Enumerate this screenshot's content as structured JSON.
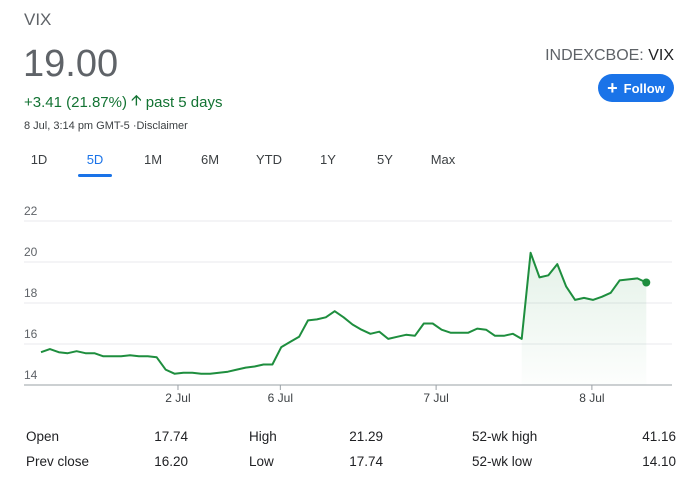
{
  "ticker": "VIX",
  "price": "19.00",
  "exchange": {
    "prefix": "INDEXCBOE: ",
    "symbol": "VIX"
  },
  "follow_label": "Follow",
  "change": {
    "value": "+3.41 (21.87%)",
    "period": "past 5 days"
  },
  "meta": "8 Jul, 3:14 pm GMT-5 ·Disclaimer",
  "tabs": [
    {
      "label": "1D",
      "active": false
    },
    {
      "label": "5D",
      "active": true
    },
    {
      "label": "1M",
      "active": false
    },
    {
      "label": "6M",
      "active": false
    },
    {
      "label": "YTD",
      "active": false
    },
    {
      "label": "1Y",
      "active": false
    },
    {
      "label": "5Y",
      "active": false
    },
    {
      "label": "Max",
      "active": false
    }
  ],
  "colors": {
    "accent": "#1a73e8",
    "positive": "#137333",
    "line": "#1e8e3e"
  },
  "chart_data": {
    "type": "area",
    "x_tick_labels": [
      "2 Jul",
      "6 Jul",
      "7 Jul",
      "8 Jul"
    ],
    "y_ticks": [
      14,
      16,
      18,
      20,
      22
    ],
    "ylim": [
      14,
      22
    ],
    "x": [
      0,
      1,
      2,
      3,
      4,
      5,
      6,
      7,
      8,
      9,
      10,
      11,
      12,
      13,
      14,
      15,
      16,
      17,
      18,
      19,
      20,
      21,
      22,
      23,
      24,
      25,
      26,
      27,
      28,
      29,
      30,
      31,
      32,
      33,
      34,
      35,
      36,
      37,
      38,
      39,
      40,
      41,
      42,
      43,
      44,
      45,
      46,
      47,
      48,
      49,
      50,
      51,
      52,
      53,
      54,
      55,
      56,
      57,
      58,
      59,
      60,
      61,
      62,
      63,
      64,
      65,
      66,
      67,
      68,
      69,
      70,
      71
    ],
    "values": [
      15.6,
      15.75,
      15.6,
      15.55,
      15.65,
      15.55,
      15.55,
      15.4,
      15.4,
      15.4,
      15.45,
      15.4,
      15.4,
      15.35,
      14.75,
      14.55,
      14.6,
      14.6,
      14.55,
      14.55,
      14.6,
      14.65,
      14.75,
      14.85,
      14.9,
      15.0,
      15.0,
      15.85,
      16.1,
      16.35,
      17.15,
      17.2,
      17.3,
      17.6,
      17.3,
      16.95,
      16.7,
      16.5,
      16.6,
      16.25,
      16.35,
      16.45,
      16.4,
      17.0,
      17.0,
      16.7,
      16.55,
      16.55,
      16.55,
      16.75,
      16.7,
      16.4,
      16.4,
      16.5,
      16.25,
      20.45,
      19.25,
      19.35,
      19.9,
      18.8,
      18.15,
      18.25,
      18.15,
      18.3,
      18.5,
      19.1,
      19.15,
      19.2,
      19.0
    ],
    "grid": true,
    "last_point_marker": true
  },
  "stats": [
    {
      "label": "Open",
      "value": "17.74"
    },
    {
      "label": "High",
      "value": "21.29"
    },
    {
      "label": "52-wk high",
      "value": "41.16"
    },
    {
      "label": "Prev close",
      "value": "16.20"
    },
    {
      "label": "Low",
      "value": "17.74"
    },
    {
      "label": "52-wk low",
      "value": "14.10"
    }
  ]
}
